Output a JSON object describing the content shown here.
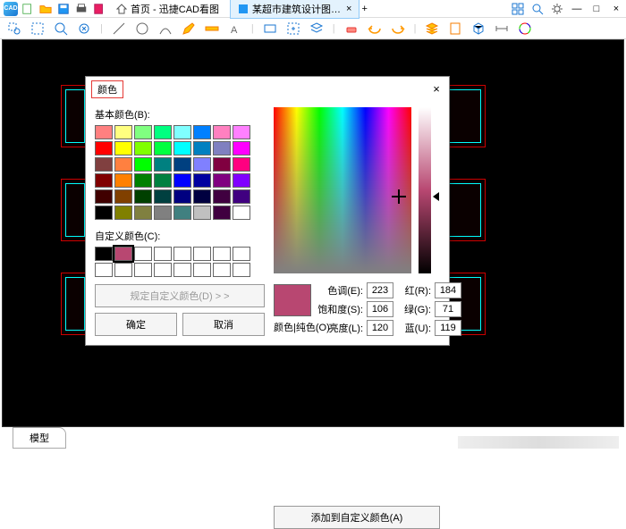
{
  "titlebar": {
    "tabs": [
      {
        "label": "首页 - 迅捷CAD看图",
        "active": false
      },
      {
        "label": "某超市建筑设计图…",
        "active": true
      }
    ]
  },
  "dialog": {
    "title": "颜色",
    "basic_label": "基本颜色(B):",
    "custom_label": "自定义颜色(C):",
    "define_btn": "规定自定义颜色(D) > >",
    "ok": "确定",
    "cancel": "取消",
    "solid_label": "颜色|纯色(O)",
    "add_custom": "添加到自定义颜色(A)",
    "fields": {
      "hue_label": "色调(E):",
      "hue": "223",
      "sat_label": "饱和度(S):",
      "sat": "106",
      "lum_label": "亮度(L):",
      "lum": "120",
      "red_label": "红(R):",
      "red": "184",
      "green_label": "绿(G):",
      "green": "71",
      "blue_label": "蓝(U):",
      "blue": "119"
    },
    "basic_colors": [
      "#ff8080",
      "#ffff80",
      "#80ff80",
      "#00ff80",
      "#80ffff",
      "#0080ff",
      "#ff80c0",
      "#ff80ff",
      "#ff0000",
      "#ffff00",
      "#80ff00",
      "#00ff40",
      "#00ffff",
      "#0080c0",
      "#8080c0",
      "#ff00ff",
      "#804040",
      "#ff8040",
      "#00ff00",
      "#008080",
      "#004080",
      "#8080ff",
      "#800040",
      "#ff0080",
      "#800000",
      "#ff8000",
      "#008000",
      "#008040",
      "#0000ff",
      "#0000a0",
      "#800080",
      "#8000ff",
      "#400000",
      "#804000",
      "#004000",
      "#004040",
      "#000080",
      "#000040",
      "#400040",
      "#400080",
      "#000000",
      "#808000",
      "#808040",
      "#808080",
      "#408080",
      "#c0c0c0",
      "#400040",
      "#ffffff"
    ],
    "custom_colors": [
      "#000000",
      "#b84771",
      "#ffffff",
      "#ffffff",
      "#ffffff",
      "#ffffff",
      "#ffffff",
      "#ffffff",
      "#ffffff",
      "#ffffff",
      "#ffffff",
      "#ffffff",
      "#ffffff",
      "#ffffff",
      "#ffffff",
      "#ffffff"
    ],
    "selected_basic": -1,
    "selected_custom": 1,
    "preview_color": "#b84771"
  },
  "bottom_tab": "模型"
}
